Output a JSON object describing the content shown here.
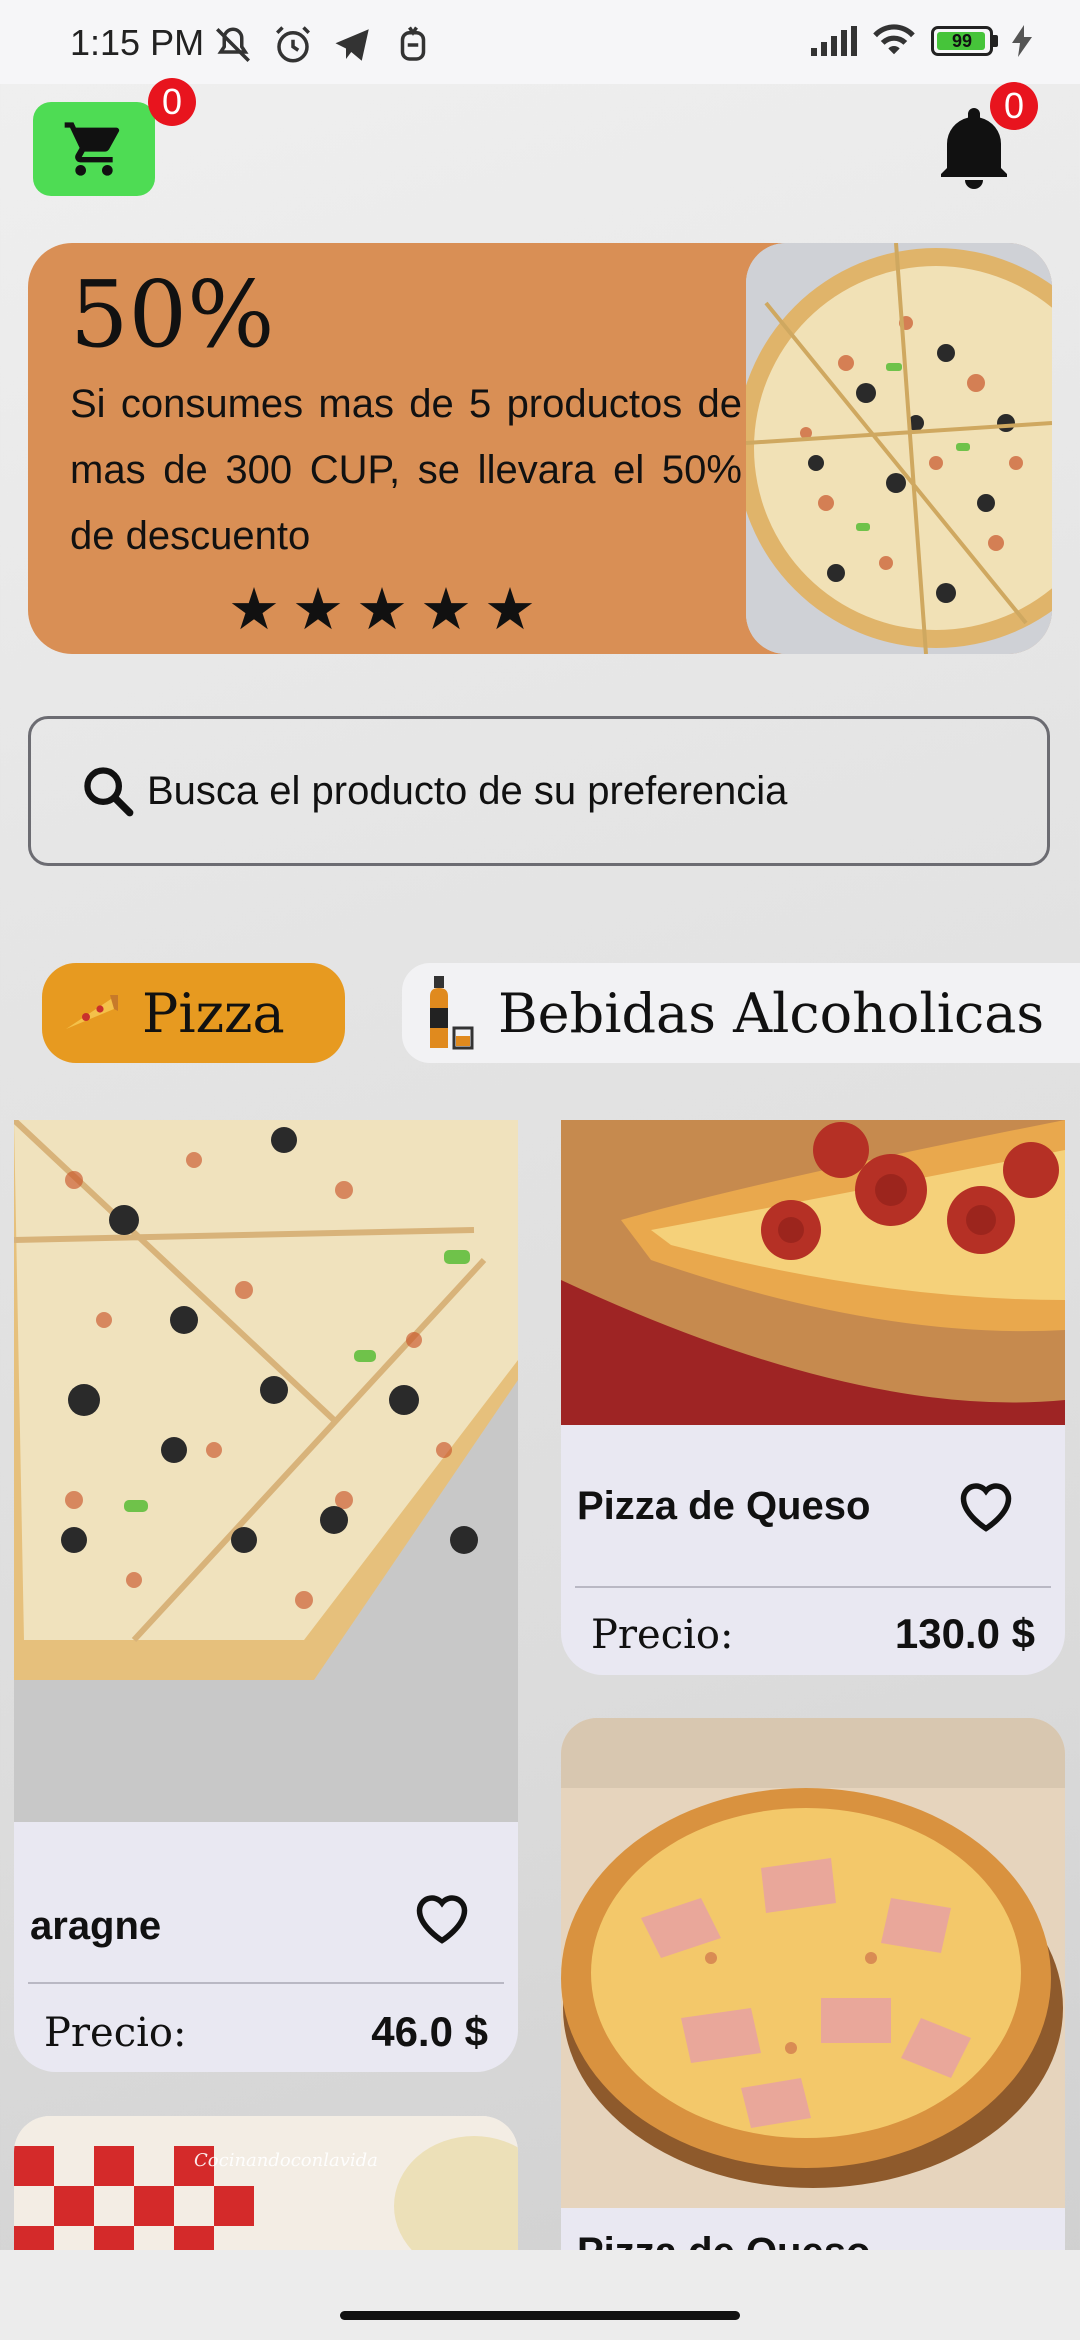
{
  "status_bar": {
    "time": "1:15 PM",
    "battery": "99",
    "icons": [
      "mute-icon",
      "alarm-icon",
      "telegram-icon",
      "app-notification-icon",
      "signal-icon",
      "wifi-icon",
      "battery-icon",
      "charging-icon"
    ]
  },
  "header": {
    "cart_count": "0",
    "notification_count": "0",
    "cart_color": "#4edc54",
    "badge_color": "#e8141e"
  },
  "promo": {
    "percent": "50%",
    "text": "Si consumes mas de 5 productos de mas de 300 CUP, se llevara el 50% de descuento",
    "stars": [
      "★",
      "★",
      "★",
      "★",
      "★"
    ],
    "rating": 5,
    "background": "#d98f55"
  },
  "search": {
    "placeholder": "Busca el producto de su preferencia"
  },
  "categories": [
    {
      "label": "Pizza",
      "icon": "pizza-icon",
      "selected": true,
      "color": "#e79a20"
    },
    {
      "label": "Bebidas Alcoholicas",
      "icon": "bottle-icon",
      "selected": false
    }
  ],
  "products": [
    {
      "name": "aragne",
      "price_label": "Precio:",
      "price": "46.0 $",
      "favorite": false
    },
    {
      "name": "Pizza de Queso",
      "price_label": "Precio:",
      "price": "130.0 $",
      "favorite": false
    },
    {
      "name": "Pizza de Queso",
      "favorite": false
    }
  ],
  "watermark": "Cocinandoconlavida"
}
